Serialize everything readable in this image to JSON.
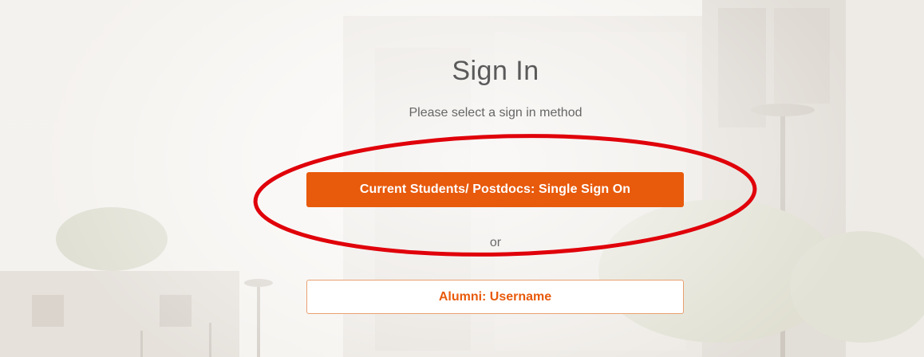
{
  "signin": {
    "title": "Sign In",
    "subtitle": "Please select a sign in method",
    "primary_button_label": "Current Students/ Postdocs: Single Sign On",
    "divider_text": "or",
    "secondary_button_label": "Alumni: Username"
  },
  "colors": {
    "accent": "#e85a0c",
    "annotation": "#e0000a"
  },
  "icons": [
    "highlight-ellipse"
  ]
}
